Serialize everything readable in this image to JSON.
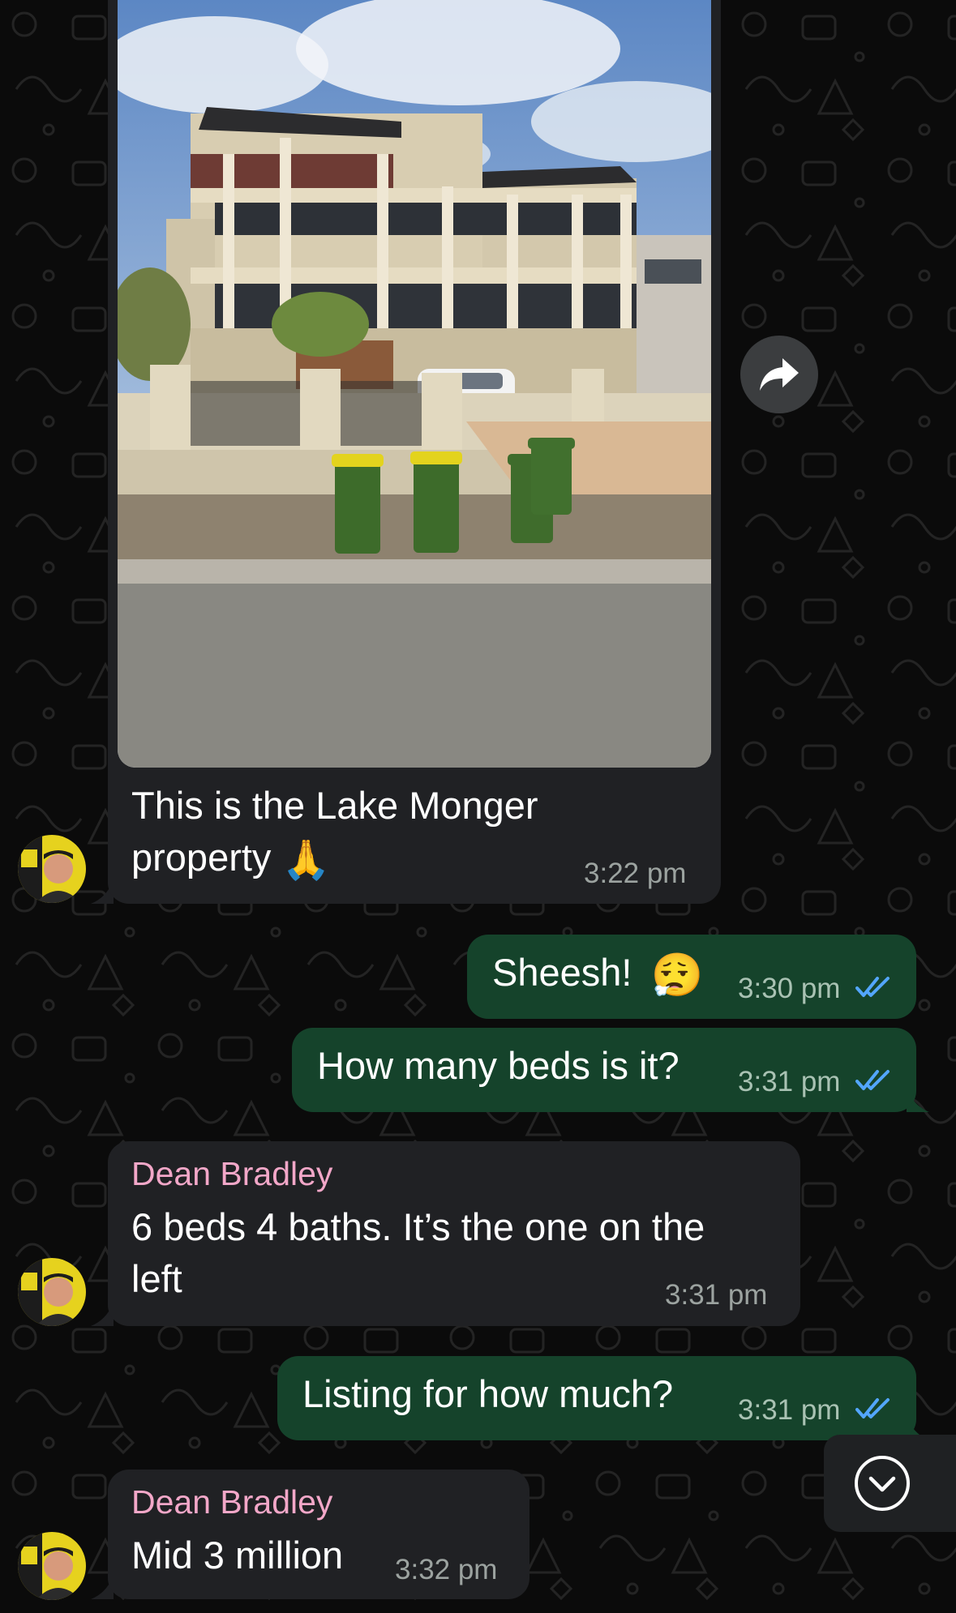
{
  "messages": [
    {
      "id": "m1",
      "direction": "incoming",
      "has_photo": true,
      "text_line1": "This is the Lake Monger",
      "text_line2": "property",
      "emoji": "🙏",
      "time": "3:22 pm"
    },
    {
      "id": "m2",
      "direction": "outgoing",
      "text": "Sheesh!",
      "emoji": "😮‍💨",
      "time": "3:30 pm",
      "status": "read"
    },
    {
      "id": "m3",
      "direction": "outgoing",
      "text": "How many beds is it?",
      "time": "3:31 pm",
      "status": "read"
    },
    {
      "id": "m4",
      "direction": "incoming",
      "sender": "Dean Bradley",
      "text_line1": "6 beds 4 baths. It’s the one on the",
      "text_line2": "left",
      "time": "3:31 pm"
    },
    {
      "id": "m5",
      "direction": "outgoing",
      "text": "Listing for how much?",
      "time": "3:31 pm",
      "status": "read"
    },
    {
      "id": "m6",
      "direction": "incoming",
      "sender": "Dean Bradley",
      "text": "Mid 3 million",
      "time": "3:32 pm"
    }
  ],
  "icons": {
    "forward": "forward-arrow-icon",
    "scroll_down": "chevron-down-icon",
    "read_receipt": "double-check-icon"
  },
  "colors": {
    "background": "#0b0b0b",
    "incoming_bubble": "#202124",
    "outgoing_bubble": "#15432b",
    "sender_name": "#f2a7c8",
    "read_tick": "#53a6ff"
  }
}
